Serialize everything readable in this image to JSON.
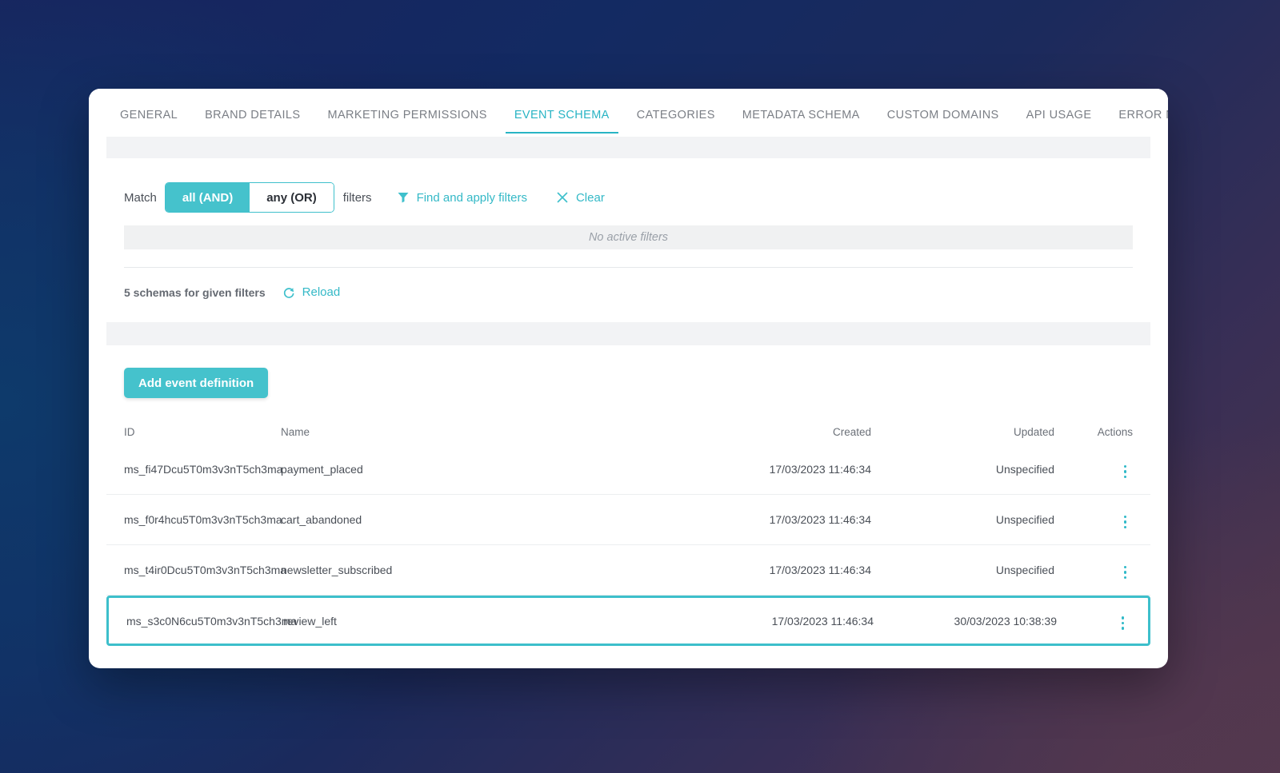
{
  "theme": {
    "accent": "#45c2cc",
    "accent_link": "#34b9c7",
    "bg_navy": "#16245f",
    "bg_purple": "#4c3449",
    "strip_gray": "#f2f3f5"
  },
  "tabs": [
    {
      "label": "GENERAL",
      "active": false
    },
    {
      "label": "BRAND DETAILS",
      "active": false
    },
    {
      "label": "MARKETING PERMISSIONS",
      "active": false
    },
    {
      "label": "EVENT SCHEMA",
      "active": true
    },
    {
      "label": "CATEGORIES",
      "active": false
    },
    {
      "label": "METADATA SCHEMA",
      "active": false
    },
    {
      "label": "CUSTOM DOMAINS",
      "active": false
    },
    {
      "label": "API USAGE",
      "active": false
    },
    {
      "label": "ERROR MESSAGES",
      "active": false
    }
  ],
  "filters": {
    "match_label": "Match",
    "toggle": {
      "and_label": "all (AND)",
      "or_label": "any (OR)",
      "selected": "all (AND)"
    },
    "filters_label": "filters",
    "find_apply_label": "Find and apply filters",
    "clear_label": "Clear",
    "empty_state": "No active filters"
  },
  "results": {
    "count_label": "5 schemas for given filters",
    "reload_label": "Reload"
  },
  "actions": {
    "add_event_definition": "Add event definition"
  },
  "table": {
    "columns": [
      "ID",
      "Name",
      "Created",
      "Updated",
      "Actions"
    ],
    "rows": [
      {
        "id": "ms_fi47Dcu5T0m3v3nT5ch3ma",
        "name": "payment_placed",
        "created": "17/03/2023 11:46:34",
        "updated": "Unspecified",
        "highlighted": false
      },
      {
        "id": "ms_f0r4hcu5T0m3v3nT5ch3ma",
        "name": "cart_abandoned",
        "created": "17/03/2023 11:46:34",
        "updated": "Unspecified",
        "highlighted": false
      },
      {
        "id": "ms_t4ir0Dcu5T0m3v3nT5ch3ma",
        "name": "newsletter_subscribed",
        "created": "17/03/2023 11:46:34",
        "updated": "Unspecified",
        "highlighted": false
      },
      {
        "id": "ms_s3c0N6cu5T0m3v3nT5ch3ma",
        "name": "review_left",
        "created": "17/03/2023 11:46:34",
        "updated": "30/03/2023 10:38:39",
        "highlighted": true
      }
    ]
  },
  "icons": {
    "filter": "filter-icon",
    "close": "close-icon",
    "reload": "reload-icon",
    "kebab": "kebab-menu-icon"
  }
}
